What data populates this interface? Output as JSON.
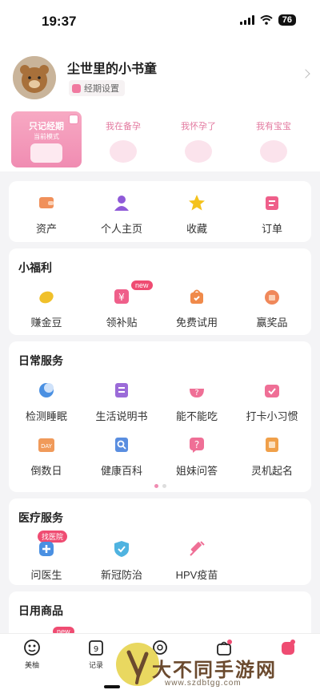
{
  "status": {
    "time": "19:37",
    "battery": "76"
  },
  "profile": {
    "username": "尘世里的小书童",
    "period_settings": "经期设置"
  },
  "modes": [
    {
      "label": "只记经期",
      "sub": "当前模式"
    },
    {
      "label": "我在备孕"
    },
    {
      "label": "我怀孕了"
    },
    {
      "label": "我有宝宝"
    }
  ],
  "quick": {
    "items": [
      {
        "label": "资产",
        "icon": "wallet-icon",
        "color": "#f0905a"
      },
      {
        "label": "个人主页",
        "icon": "person-icon",
        "color": "#8f5ad8"
      },
      {
        "label": "收藏",
        "icon": "star-icon",
        "color": "#f4c21c"
      },
      {
        "label": "订单",
        "icon": "order-icon",
        "color": "#ef5f8a"
      }
    ]
  },
  "welfare": {
    "title": "小福利",
    "new_badge": "new",
    "items": [
      {
        "label": "赚金豆",
        "icon": "gold-bean-icon",
        "color": "#f0c02a"
      },
      {
        "label": "领补贴",
        "icon": "subsidy-icon",
        "color": "#ef5f8a"
      },
      {
        "label": "免费试用",
        "icon": "trial-bag-icon",
        "color": "#f08a4a"
      },
      {
        "label": "赢奖品",
        "icon": "prize-icon",
        "color": "#f0885a"
      }
    ]
  },
  "daily": {
    "title": "日常服务",
    "items": [
      {
        "label": "检测睡眠",
        "icon": "sleep-icon",
        "color": "#4a90e2"
      },
      {
        "label": "生活说明书",
        "icon": "manual-icon",
        "color": "#9b6bd8"
      },
      {
        "label": "能不能吃",
        "icon": "food-bowl-icon",
        "color": "#ef6f96"
      },
      {
        "label": "打卡小习惯",
        "icon": "check-in-icon",
        "color": "#ef6f96"
      },
      {
        "label": "倒数日",
        "icon": "countdown-icon",
        "color": "#f09a5a",
        "text": "DAY"
      },
      {
        "label": "健康百科",
        "icon": "encyclopedia-icon",
        "color": "#5a8ee0"
      },
      {
        "label": "姐妹问答",
        "icon": "question-icon",
        "color": "#ef6f96"
      },
      {
        "label": "灵机起名",
        "icon": "naming-icon",
        "color": "#f0a04a"
      }
    ]
  },
  "medical": {
    "title": "医疗服务",
    "badge": "找医院",
    "items": [
      {
        "label": "问医生",
        "icon": "doctor-icon",
        "color": "#4a90e2"
      },
      {
        "label": "新冠防治",
        "icon": "shield-icon",
        "color": "#4fb3e0"
      },
      {
        "label": "HPV疫苗",
        "icon": "vaccine-icon",
        "color": "#ef6f96"
      }
    ]
  },
  "goods": {
    "title": "日用商品",
    "new_badge": "new"
  },
  "tabbar": [
    {
      "label": "美柚",
      "icon": "meiyou-icon"
    },
    {
      "label": "记录",
      "icon": "calendar-icon",
      "num": "9"
    },
    {
      "label": "",
      "icon": "circle-tab-icon"
    },
    {
      "label": "",
      "icon": "bag-tab-icon"
    },
    {
      "label": "",
      "icon": "me-tab-icon"
    }
  ],
  "watermark": {
    "text": "大不同手游网",
    "url": "www.szdbtgg.com"
  }
}
